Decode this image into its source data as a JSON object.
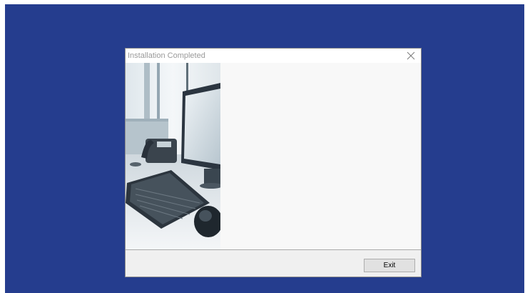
{
  "dialog": {
    "title": "Installation Completed",
    "close_icon": "close-icon",
    "side_image": "office-desk-computer-illustration"
  },
  "footer": {
    "exit_label": "Exit"
  },
  "colors": {
    "desktop_background": "#253d8e",
    "dialog_content_background": "#f8f8f8",
    "title_text": "#9a9a9a"
  }
}
